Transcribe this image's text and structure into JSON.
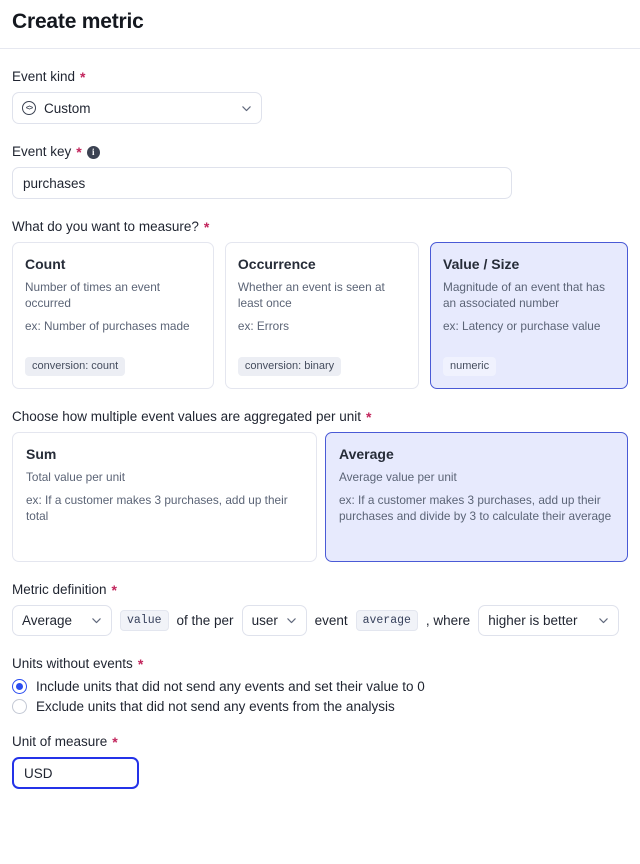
{
  "header": {
    "title": "Create metric"
  },
  "event_kind": {
    "label": "Event kind",
    "required_mark": "*",
    "icon": "code-circle-icon",
    "value": "Custom",
    "chevron": "chevron-down-icon"
  },
  "event_key": {
    "label": "Event key",
    "required_mark": "*",
    "info_icon": "info-icon",
    "info_glyph": "i",
    "value": "purchases",
    "placeholder": "Event key"
  },
  "measure": {
    "label": "What do you want to measure?",
    "required_mark": "*",
    "options": [
      {
        "title": "Count",
        "desc": "Number of times an event occurred",
        "ex": "ex: Number of purchases made",
        "tag": "conversion: count",
        "selected": false
      },
      {
        "title": "Occurrence",
        "desc": "Whether an event is seen at least once",
        "ex": "ex: Errors",
        "tag": "conversion: binary",
        "selected": false
      },
      {
        "title": "Value / Size",
        "desc": "Magnitude of an event that has an associated number",
        "ex": "ex: Latency or purchase value",
        "tag": "numeric",
        "selected": true
      }
    ]
  },
  "aggregation": {
    "label": "Choose how multiple event values are aggregated per unit",
    "required_mark": "*",
    "options": [
      {
        "title": "Sum",
        "desc": "Total value per unit",
        "ex": "ex: If a customer makes 3 purchases, add up their total",
        "selected": false
      },
      {
        "title": "Average",
        "desc": "Average value per unit",
        "ex": "ex: If a customer makes 3 purchases, add up their purchases and divide by 3 to calculate their average",
        "selected": true
      }
    ]
  },
  "metric_definition": {
    "label": "Metric definition",
    "required_mark": "*",
    "agg_select": "Average",
    "value_chip": "value",
    "text_of_the_per": "of the per",
    "unit_select": "user",
    "text_event": "event",
    "average_chip": "average",
    "text_where": ", where",
    "direction_select": "higher is better",
    "chevron": "chevron-down-icon"
  },
  "units_without_events": {
    "label": "Units without events",
    "required_mark": "*",
    "options": [
      {
        "label": "Include units that did not send any events and set their value to 0",
        "selected": true
      },
      {
        "label": "Exclude units that did not send any events from the analysis",
        "selected": false
      }
    ]
  },
  "unit_of_measure": {
    "label": "Unit of measure",
    "required_mark": "*",
    "value": "USD",
    "placeholder": "Unit of measure"
  },
  "colors": {
    "accent_blue": "#2a4cf0",
    "selected_card_bg": "#e7eafd",
    "selected_card_border": "#4a5ad6",
    "required_star": "#c2255c",
    "focus_border": "#2433e8"
  }
}
